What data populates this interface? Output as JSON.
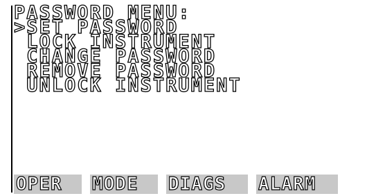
{
  "menu": {
    "title": "PASSWORD MENU:",
    "items": [
      {
        "label": "SET PASSWORD",
        "prefix": ">"
      },
      {
        "label": "LOCK INSTRUMENT",
        "prefix": " "
      },
      {
        "label": "CHANGE PASSWORD",
        "prefix": " "
      },
      {
        "label": "REMOVE PASSWORD",
        "prefix": " "
      },
      {
        "label": "UNLOCK INSTRUMENT",
        "prefix": " "
      }
    ]
  },
  "softkeys": {
    "oper": "OPER",
    "mode": "MODE",
    "diags": "DIAGS",
    "alarm": "ALARM"
  }
}
